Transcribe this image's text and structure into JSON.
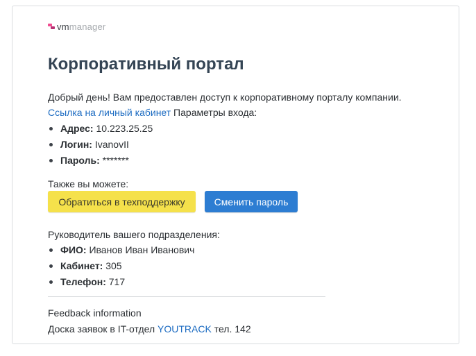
{
  "logo": {
    "vm": "vm",
    "manager": "manager"
  },
  "title": "Корпоративный портал",
  "greeting": "Добрый день! Вам предоставлен доступ к корпоративному порталу компании.",
  "cabinet_link": "Ссылка на личный кабинет",
  "login_params_label": " Параметры входа:",
  "credentials": [
    {
      "label": "Адрес:",
      "value": " 10.223.25.25"
    },
    {
      "label": "Логин:",
      "value": " IvanovII"
    },
    {
      "label": "Пароль:",
      "value": " *******"
    }
  ],
  "also_label": "Также вы можете:",
  "buttons": {
    "support": "Обратиться в техподдержку",
    "change_password": "Сменить пароль"
  },
  "manager_heading": "Руководитель вашего подразделения:",
  "manager": [
    {
      "label": "ФИО:",
      "value": " Иванов Иван Иванович"
    },
    {
      "label": "Кабинет:",
      "value": " 305"
    },
    {
      "label": "Телефон:",
      "value": " 717"
    }
  ],
  "feedback_title": "Feedback information",
  "desk": {
    "prefix": "Доска заявок в IT-отдел ",
    "link": "YOUTRACK",
    "suffix": " тел. 142"
  },
  "colors": {
    "title": "#344454",
    "link": "#1d6cc2",
    "support_button": "#f5e14b",
    "password_button": "#2d7dd2"
  }
}
